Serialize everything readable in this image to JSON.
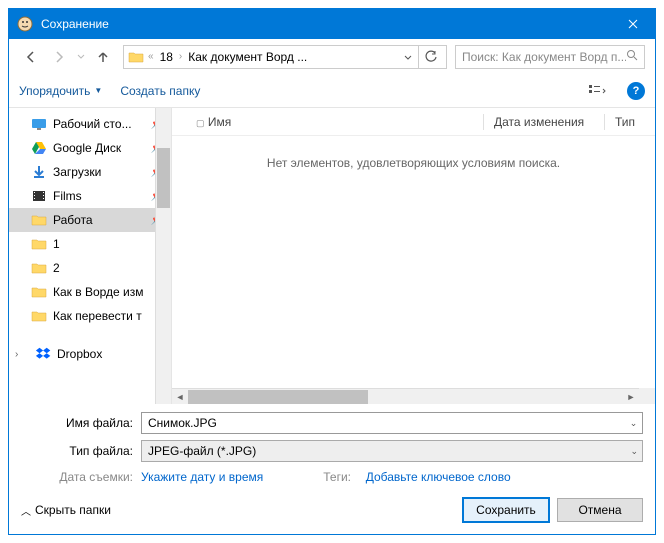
{
  "title": "Сохранение",
  "breadcrumb": {
    "seg1": "18",
    "seg2": "Как документ Ворд ..."
  },
  "search": {
    "placeholder": "Поиск: Как документ Ворд п..."
  },
  "toolbar": {
    "organize": "Упорядочить",
    "newfolder": "Создать папку"
  },
  "sidebar": {
    "items": [
      {
        "label": "Рабочий сто...",
        "pin": true,
        "kind": "desktop"
      },
      {
        "label": "Google Диск",
        "pin": true,
        "kind": "gdrive"
      },
      {
        "label": "Загрузки",
        "pin": true,
        "kind": "downloads"
      },
      {
        "label": "Films",
        "pin": true,
        "kind": "films"
      },
      {
        "label": "Работа",
        "pin": true,
        "kind": "folder",
        "selected": true
      },
      {
        "label": "1",
        "pin": false,
        "kind": "folder"
      },
      {
        "label": "2",
        "pin": false,
        "kind": "folder"
      },
      {
        "label": "Как в Ворде изм",
        "pin": false,
        "kind": "folder"
      },
      {
        "label": "Как перевести т",
        "pin": false,
        "kind": "folder"
      }
    ],
    "dropbox": "Dropbox"
  },
  "columns": {
    "name": "Имя",
    "date": "Дата изменения",
    "type": "Тип"
  },
  "empty": "Нет элементов, удовлетворяющих условиям поиска.",
  "filename_label": "Имя файла:",
  "filename_value": "Снимок.JPG",
  "filetype_label": "Тип файла:",
  "filetype_value": "JPEG-файл (*.JPG)",
  "meta": {
    "date_label": "Дата съемки:",
    "date_link": "Укажите дату и время",
    "tags_label": "Теги:",
    "tags_link": "Добавьте ключевое слово"
  },
  "collapse": "Скрыть папки",
  "save": "Сохранить",
  "cancel": "Отмена"
}
